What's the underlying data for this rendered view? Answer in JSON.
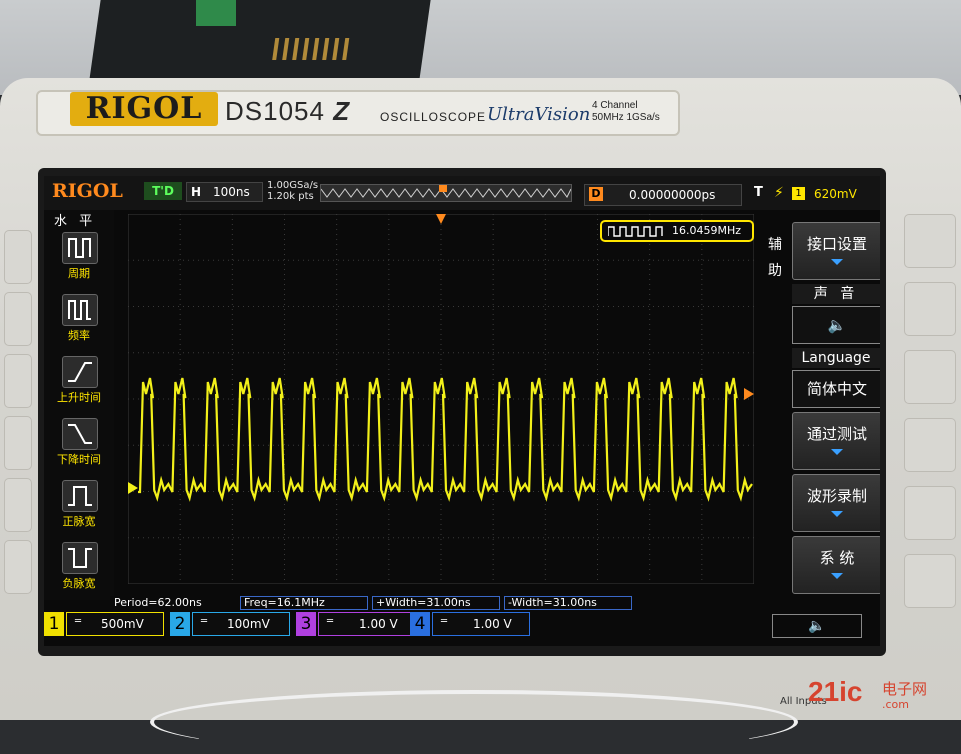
{
  "device": {
    "brand": "RIGOL",
    "model": "DS1054",
    "model_suffix": "Z",
    "type_label": "OSCILLOSCOPE",
    "series": "UltraVision",
    "spec_line1": "4 Channel",
    "spec_line2": "50MHz 1GSa/s"
  },
  "top_bar": {
    "brand": "RIGOL",
    "run_state": "T'D",
    "timebase_prefix": "H",
    "timebase": "100ns",
    "sample_rate": "1.00GSa/s",
    "memory_depth": "1.20k pts",
    "delay_prefix": "D",
    "delay": "0.00000000ps",
    "trigger_prefix": "T",
    "trigger_channel": "1",
    "trigger_level": "620mV"
  },
  "freq_counter": "16.0459MHz",
  "left_menu": {
    "title": "水 平",
    "items": [
      "周期",
      "频率",
      "上升时间",
      "下降时间",
      "正脉宽",
      "负脉宽"
    ]
  },
  "right_menu": {
    "side_label": "辅助",
    "interface_btn": "接口设置",
    "sound_head": "声 音",
    "sound_value": "🔈",
    "language_head": "Language",
    "language_value": "简体中文",
    "passfail_btn": "通过测试",
    "record_btn": "波形录制",
    "system_btn": "系 统"
  },
  "measurements": [
    "Period=62.00ns",
    "Freq=16.1MHz",
    "+Width=31.00ns",
    "-Width=31.00ns"
  ],
  "channels": [
    {
      "num": "1",
      "scale": "500mV",
      "color": "#f0e000"
    },
    {
      "num": "2",
      "scale": "100mV",
      "color": "#29a8e8"
    },
    {
      "num": "3",
      "scale": "1.00 V",
      "color": "#b040e0"
    },
    {
      "num": "4",
      "scale": "1.00 V",
      "color": "#2a6fe0"
    }
  ],
  "bottom_note": "All Inputs",
  "watermark": {
    "main": "21ic",
    "cn": "电子网",
    "domain": ".com"
  },
  "waveform": {
    "color": "#f2f01a",
    "frequency_mhz": 16.0459,
    "cycles_visible": 19
  }
}
